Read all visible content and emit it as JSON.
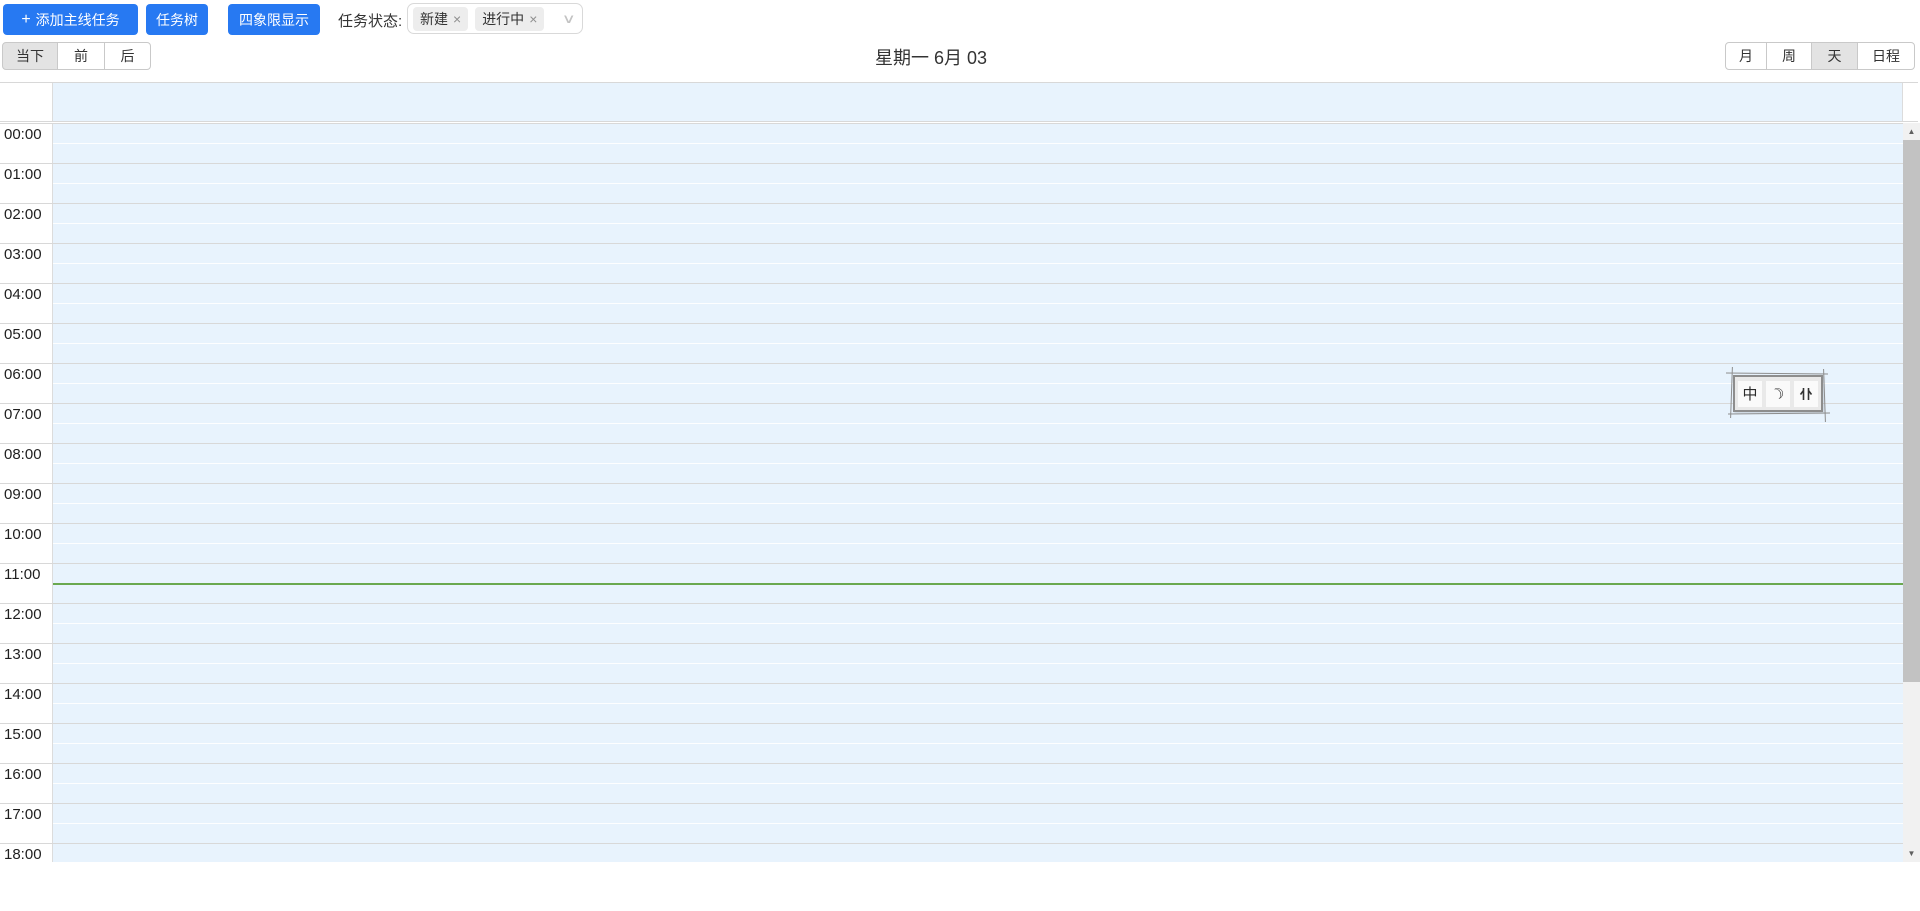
{
  "colors": {
    "accent_blue": "#2779f2",
    "grid_background": "#e8f3fd",
    "now_line": "#6aa84f",
    "hour_line": "#d8d8d8",
    "active_button_bg": "#e3e3e3"
  },
  "toolbar": {
    "plus_icon": "+",
    "add_main_task_label": "添加主线任务",
    "task_tree_label": "任务树",
    "quadrant_view_label": "四象限显示",
    "status_label": "任务状态:",
    "status_tags": [
      {
        "label": "新建"
      },
      {
        "label": "进行中"
      }
    ],
    "tag_close_icon": "×",
    "dropdown_icon": "∨"
  },
  "nav": {
    "today_label": "当下",
    "prev_label": "前",
    "next_label": "后",
    "title": "星期一 6月 03",
    "views": [
      {
        "label": "月",
        "active": false
      },
      {
        "label": "周",
        "active": false
      },
      {
        "label": "天",
        "active": true
      },
      {
        "label": "日程",
        "active": false
      }
    ]
  },
  "calendar": {
    "slots": [
      "00:00",
      "01:00",
      "02:00",
      "03:00",
      "04:00",
      "05:00",
      "06:00",
      "07:00",
      "08:00",
      "09:00",
      "10:00",
      "11:00",
      "12:00",
      "13:00",
      "14:00",
      "15:00",
      "16:00",
      "17:00",
      "18:00"
    ]
  },
  "ime_bar": {
    "mode_label": "中",
    "moon_icon": "☽"
  },
  "scrollbar": {
    "up_icon": "▲",
    "down_icon": "▼"
  }
}
